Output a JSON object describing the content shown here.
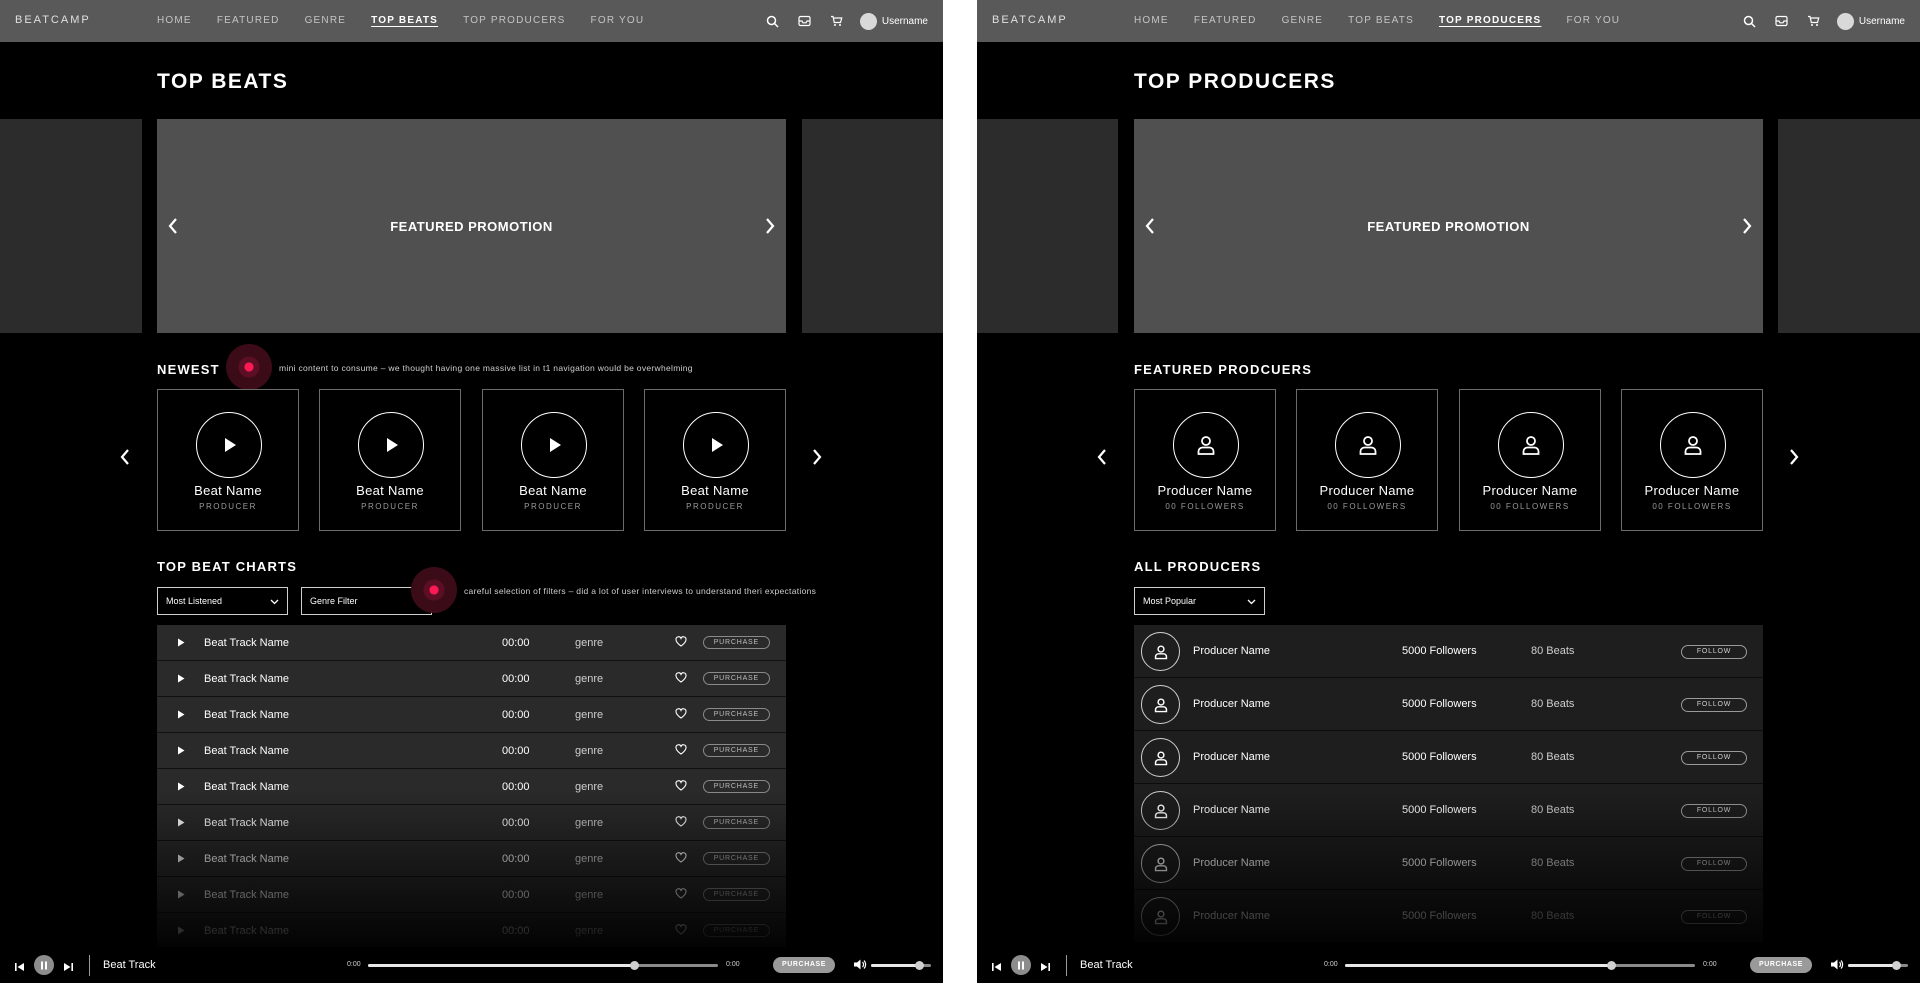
{
  "left_screen": {
    "nav": {
      "logo": "BEATCAMP",
      "links": [
        "HOME",
        "FEATURED",
        "GENRE",
        "TOP BEATS",
        "TOP PRODUCERS",
        "FOR YOU"
      ],
      "active": "TOP BEATS",
      "username": "Username",
      "icons": [
        "search-icon",
        "inbox-icon",
        "cart-icon",
        "avatar"
      ]
    },
    "title": "TOP BEATS",
    "promo_label": "FEATURED PROMOTION",
    "newest": {
      "title": "NEWEST",
      "annotation": "mini content to consume – we thought having one massive list in t1 navigation would be overwhelming",
      "cards": [
        {
          "name": "Beat Name",
          "sub": "PRODUCER"
        },
        {
          "name": "Beat Name",
          "sub": "PRODUCER"
        },
        {
          "name": "Beat Name",
          "sub": "PRODUCER"
        },
        {
          "name": "Beat Name",
          "sub": "PRODUCER"
        }
      ]
    },
    "charts": {
      "title": "TOP BEAT CHARTS",
      "filter_sort": "Most Listened",
      "filter_genre": "Genre Filter",
      "annotation": "careful selection of filters – did a lot of user interviews to understand theri expectations",
      "purchase_label": "PURCHASE",
      "tracks": [
        {
          "name": "Beat Track Name",
          "time": "00:00",
          "genre": "genre"
        },
        {
          "name": "Beat Track Name",
          "time": "00:00",
          "genre": "genre"
        },
        {
          "name": "Beat Track Name",
          "time": "00:00",
          "genre": "genre"
        },
        {
          "name": "Beat Track Name",
          "time": "00:00",
          "genre": "genre"
        },
        {
          "name": "Beat Track Name",
          "time": "00:00",
          "genre": "genre"
        },
        {
          "name": "Beat Track Name",
          "time": "00:00",
          "genre": "genre"
        },
        {
          "name": "Beat Track Name",
          "time": "00:00",
          "genre": "genre"
        },
        {
          "name": "Beat Track Name",
          "time": "00:00",
          "genre": "genre"
        },
        {
          "name": "Beat Track Name",
          "time": "00:00",
          "genre": "genre"
        }
      ]
    },
    "player": {
      "track": "Beat Track",
      "time_start": "0:00",
      "time_end": "0:00",
      "purchase": "PURCHASE",
      "progress": 0.76,
      "volume": 0.8
    }
  },
  "right_screen": {
    "nav": {
      "logo": "BEATCAMP",
      "links": [
        "HOME",
        "FEATURED",
        "GENRE",
        "TOP BEATS",
        "TOP PRODUCERS",
        "FOR YOU"
      ],
      "active": "TOP PRODUCERS",
      "username": "Username"
    },
    "title": "TOP PRODUCERS",
    "promo_label": "FEATURED PROMOTION",
    "featured": {
      "title": "FEATURED PRODCUERS",
      "cards": [
        {
          "name": "Producer Name",
          "sub": "00 FOLLOWERS"
        },
        {
          "name": "Producer Name",
          "sub": "00 FOLLOWERS"
        },
        {
          "name": "Producer Name",
          "sub": "00 FOLLOWERS"
        },
        {
          "name": "Producer Name",
          "sub": "00 FOLLOWERS"
        }
      ]
    },
    "all": {
      "title": "ALL PRODUCERS",
      "filter_sort": "Most Popular",
      "follow_label": "FOLLOW",
      "producers": [
        {
          "name": "Producer Name",
          "followers": "5000 Followers",
          "beats": "80 Beats"
        },
        {
          "name": "Producer Name",
          "followers": "5000 Followers",
          "beats": "80 Beats"
        },
        {
          "name": "Producer Name",
          "followers": "5000 Followers",
          "beats": "80 Beats"
        },
        {
          "name": "Producer Name",
          "followers": "5000 Followers",
          "beats": "80 Beats"
        },
        {
          "name": "Producer Name",
          "followers": "5000 Followers",
          "beats": "80 Beats"
        },
        {
          "name": "Producer Name",
          "followers": "5000 Followers",
          "beats": "80 Beats"
        }
      ]
    },
    "player": {
      "track": "Beat Track",
      "time_start": "0:00",
      "time_end": "0:00",
      "purchase": "PURCHASE",
      "progress": 0.76,
      "volume": 0.8
    }
  },
  "colors": {
    "annotation_dot": "#ff1a55",
    "nav_bg": "#595959",
    "promo_bg": "#505050"
  }
}
